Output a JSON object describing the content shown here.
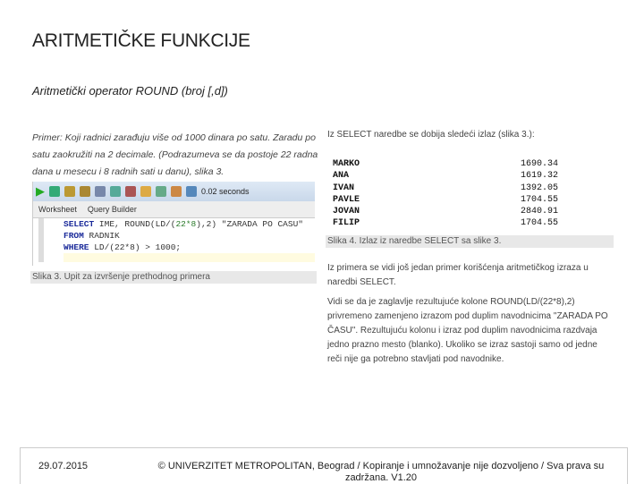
{
  "title": "ARITMETIČKE FUNKCIJE",
  "subtitle": "Aritmetički operator ROUND (broj [,d])",
  "left_text": "Primer: Koji radnici zarađuju više od 1000 dinara po satu. Zaradu po satu zaokružiti na 2 decimale. (Podrazumeva se da postoje 22 radna dana u mesecu i 8 radnih sati u danu), slika 3.",
  "screenshot": {
    "timing": "0.02 seconds",
    "tabs": [
      "Worksheet",
      "Query Builder"
    ],
    "code": {
      "l1_kw": "SELECT",
      "l1": " IME, ROUND(LD/(",
      "l1_num": "22*8",
      "l1_b": "),2)  \"ZARADA PO CASU\"",
      "l2_kw": "FROM",
      "l2": " RADNIK",
      "l3_kw": "WHERE",
      "l3": " LD/(22*8) > 1000;"
    }
  },
  "caption3": "Slika 3. Upit za izvršenje prethodnog primera",
  "right_intro": "Iz SELECT naredbe se dobija sledeći izlaz (slika 3.):",
  "results": [
    {
      "name": "MARKO",
      "value": "1690.34"
    },
    {
      "name": "ANA",
      "value": "1619.32"
    },
    {
      "name": "IVAN",
      "value": "1392.05"
    },
    {
      "name": "PAVLE",
      "value": "1704.55"
    },
    {
      "name": "JOVAN",
      "value": "2840.91"
    },
    {
      "name": "FILIP",
      "value": "1704.55"
    }
  ],
  "caption4": "Slika 4. Izlaz iz naredbe SELECT sa slike 3.",
  "p1": "Iz primera se vidi još jedan primer korišćenja aritmetičkog izraza u naredbi SELECT.",
  "p2": "Vidi se da je zaglavlje rezultujuće kolone ROUND(LD/(22*8),2) privremeno zamenjeno izrazom pod duplim navodnicima \"ZARADA PO ČASU\". Rezultujuću kolonu i izraz pod duplim navodnicima razdvaja jedno prazno mesto (blanko). Ukoliko se izraz sastoji samo od jedne reči nije ga potrebno stavljati pod navodnike.",
  "footer": {
    "date": "29.07.2015",
    "copyright": "© UNIVERZITET METROPOLITAN, Beograd / Kopiranje i umnožavanje nije dozvoljeno / Sva prava su zadržana.            V1.20"
  }
}
